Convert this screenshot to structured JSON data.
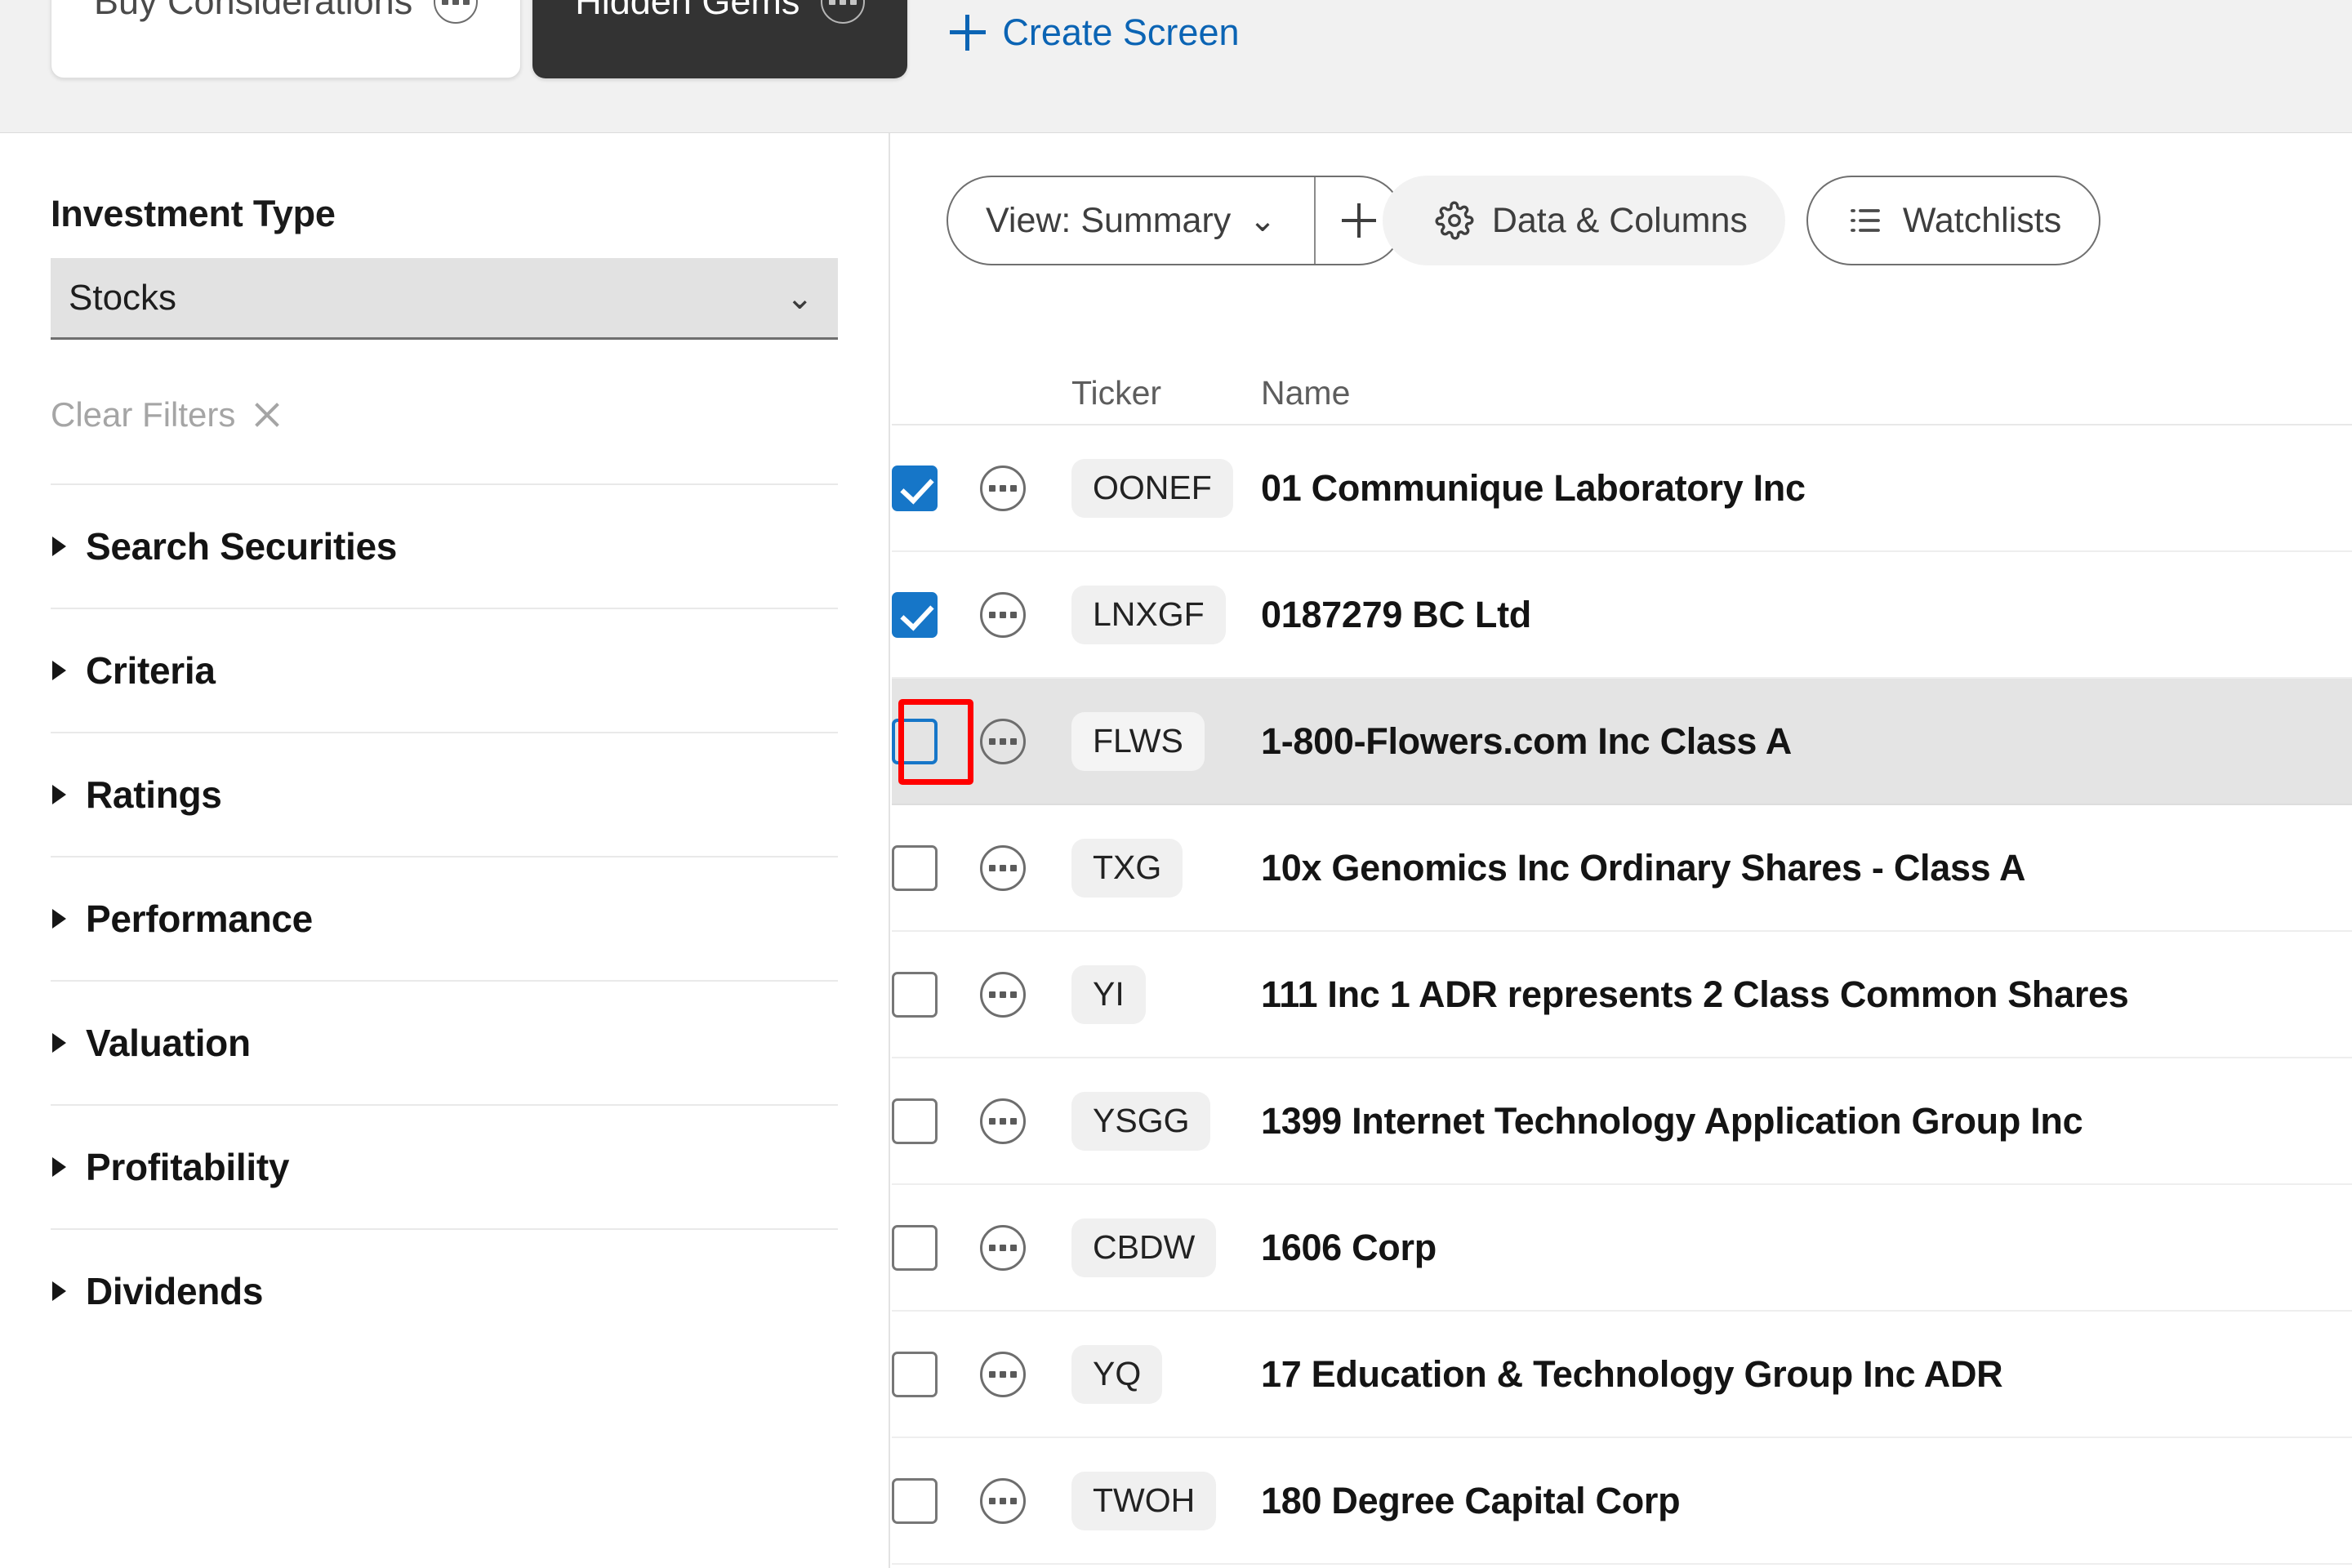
{
  "tabs": [
    {
      "label": "Buy Considerations",
      "active": false,
      "menu_icon": "ellipsis-circle-icon"
    },
    {
      "label": "Hidden Gems",
      "active": true,
      "menu_icon": "ellipsis-circle-icon"
    }
  ],
  "create_screen": {
    "label": "Create Screen",
    "icon": "plus-icon",
    "color": "#0b64b4"
  },
  "sidebar": {
    "title": "Investment Type",
    "investment_type": {
      "value": "Stocks",
      "chevron": "chevron-down-icon"
    },
    "clear_filters": {
      "label": "Clear Filters",
      "icon": "close-x-icon"
    },
    "sections": [
      {
        "label": "Search Securities",
        "expanded": false
      },
      {
        "label": "Criteria",
        "expanded": false
      },
      {
        "label": "Ratings",
        "expanded": false
      },
      {
        "label": "Performance",
        "expanded": false
      },
      {
        "label": "Valuation",
        "expanded": false
      },
      {
        "label": "Profitability",
        "expanded": false
      },
      {
        "label": "Dividends",
        "expanded": false
      }
    ]
  },
  "toolbar": {
    "view_label": "View: Summary",
    "view_chevron": "chevron-down-icon",
    "add_view_icon": "plus-icon",
    "data_columns_label": "Data & Columns",
    "data_columns_icon": "gear-icon",
    "watchlists_label": "Watchlists",
    "watchlists_icon": "list-icon"
  },
  "table": {
    "columns": [
      "",
      "",
      "Ticker",
      "Name"
    ],
    "rows": [
      {
        "checked": true,
        "focused": false,
        "highlight": false,
        "ticker": "OONEF",
        "name": "01 Communique Laboratory Inc"
      },
      {
        "checked": true,
        "focused": false,
        "highlight": false,
        "ticker": "LNXGF",
        "name": "0187279 BC Ltd"
      },
      {
        "checked": false,
        "focused": true,
        "highlight": true,
        "ticker": "FLWS",
        "name": "1-800-Flowers.com Inc Class A"
      },
      {
        "checked": false,
        "focused": false,
        "highlight": false,
        "ticker": "TXG",
        "name": "10x Genomics Inc Ordinary Shares - Class A"
      },
      {
        "checked": false,
        "focused": false,
        "highlight": false,
        "ticker": "YI",
        "name": "111 Inc 1 ADR represents 2 Class Common Shares"
      },
      {
        "checked": false,
        "focused": false,
        "highlight": false,
        "ticker": "YSGG",
        "name": "1399 Internet Technology Application Group Inc"
      },
      {
        "checked": false,
        "focused": false,
        "highlight": false,
        "ticker": "CBDW",
        "name": "1606 Corp"
      },
      {
        "checked": false,
        "focused": false,
        "highlight": false,
        "ticker": "YQ",
        "name": "17 Education & Technology Group Inc ADR"
      },
      {
        "checked": false,
        "focused": false,
        "highlight": false,
        "ticker": "TWOH",
        "name": "180 Degree Capital Corp"
      }
    ]
  },
  "colors": {
    "accent_blue": "#1676c8",
    "link_blue": "#0b64b4",
    "active_tab_bg": "#333333",
    "annotation_red": "#ff0000",
    "highlight_row": "#e4e4e4"
  }
}
